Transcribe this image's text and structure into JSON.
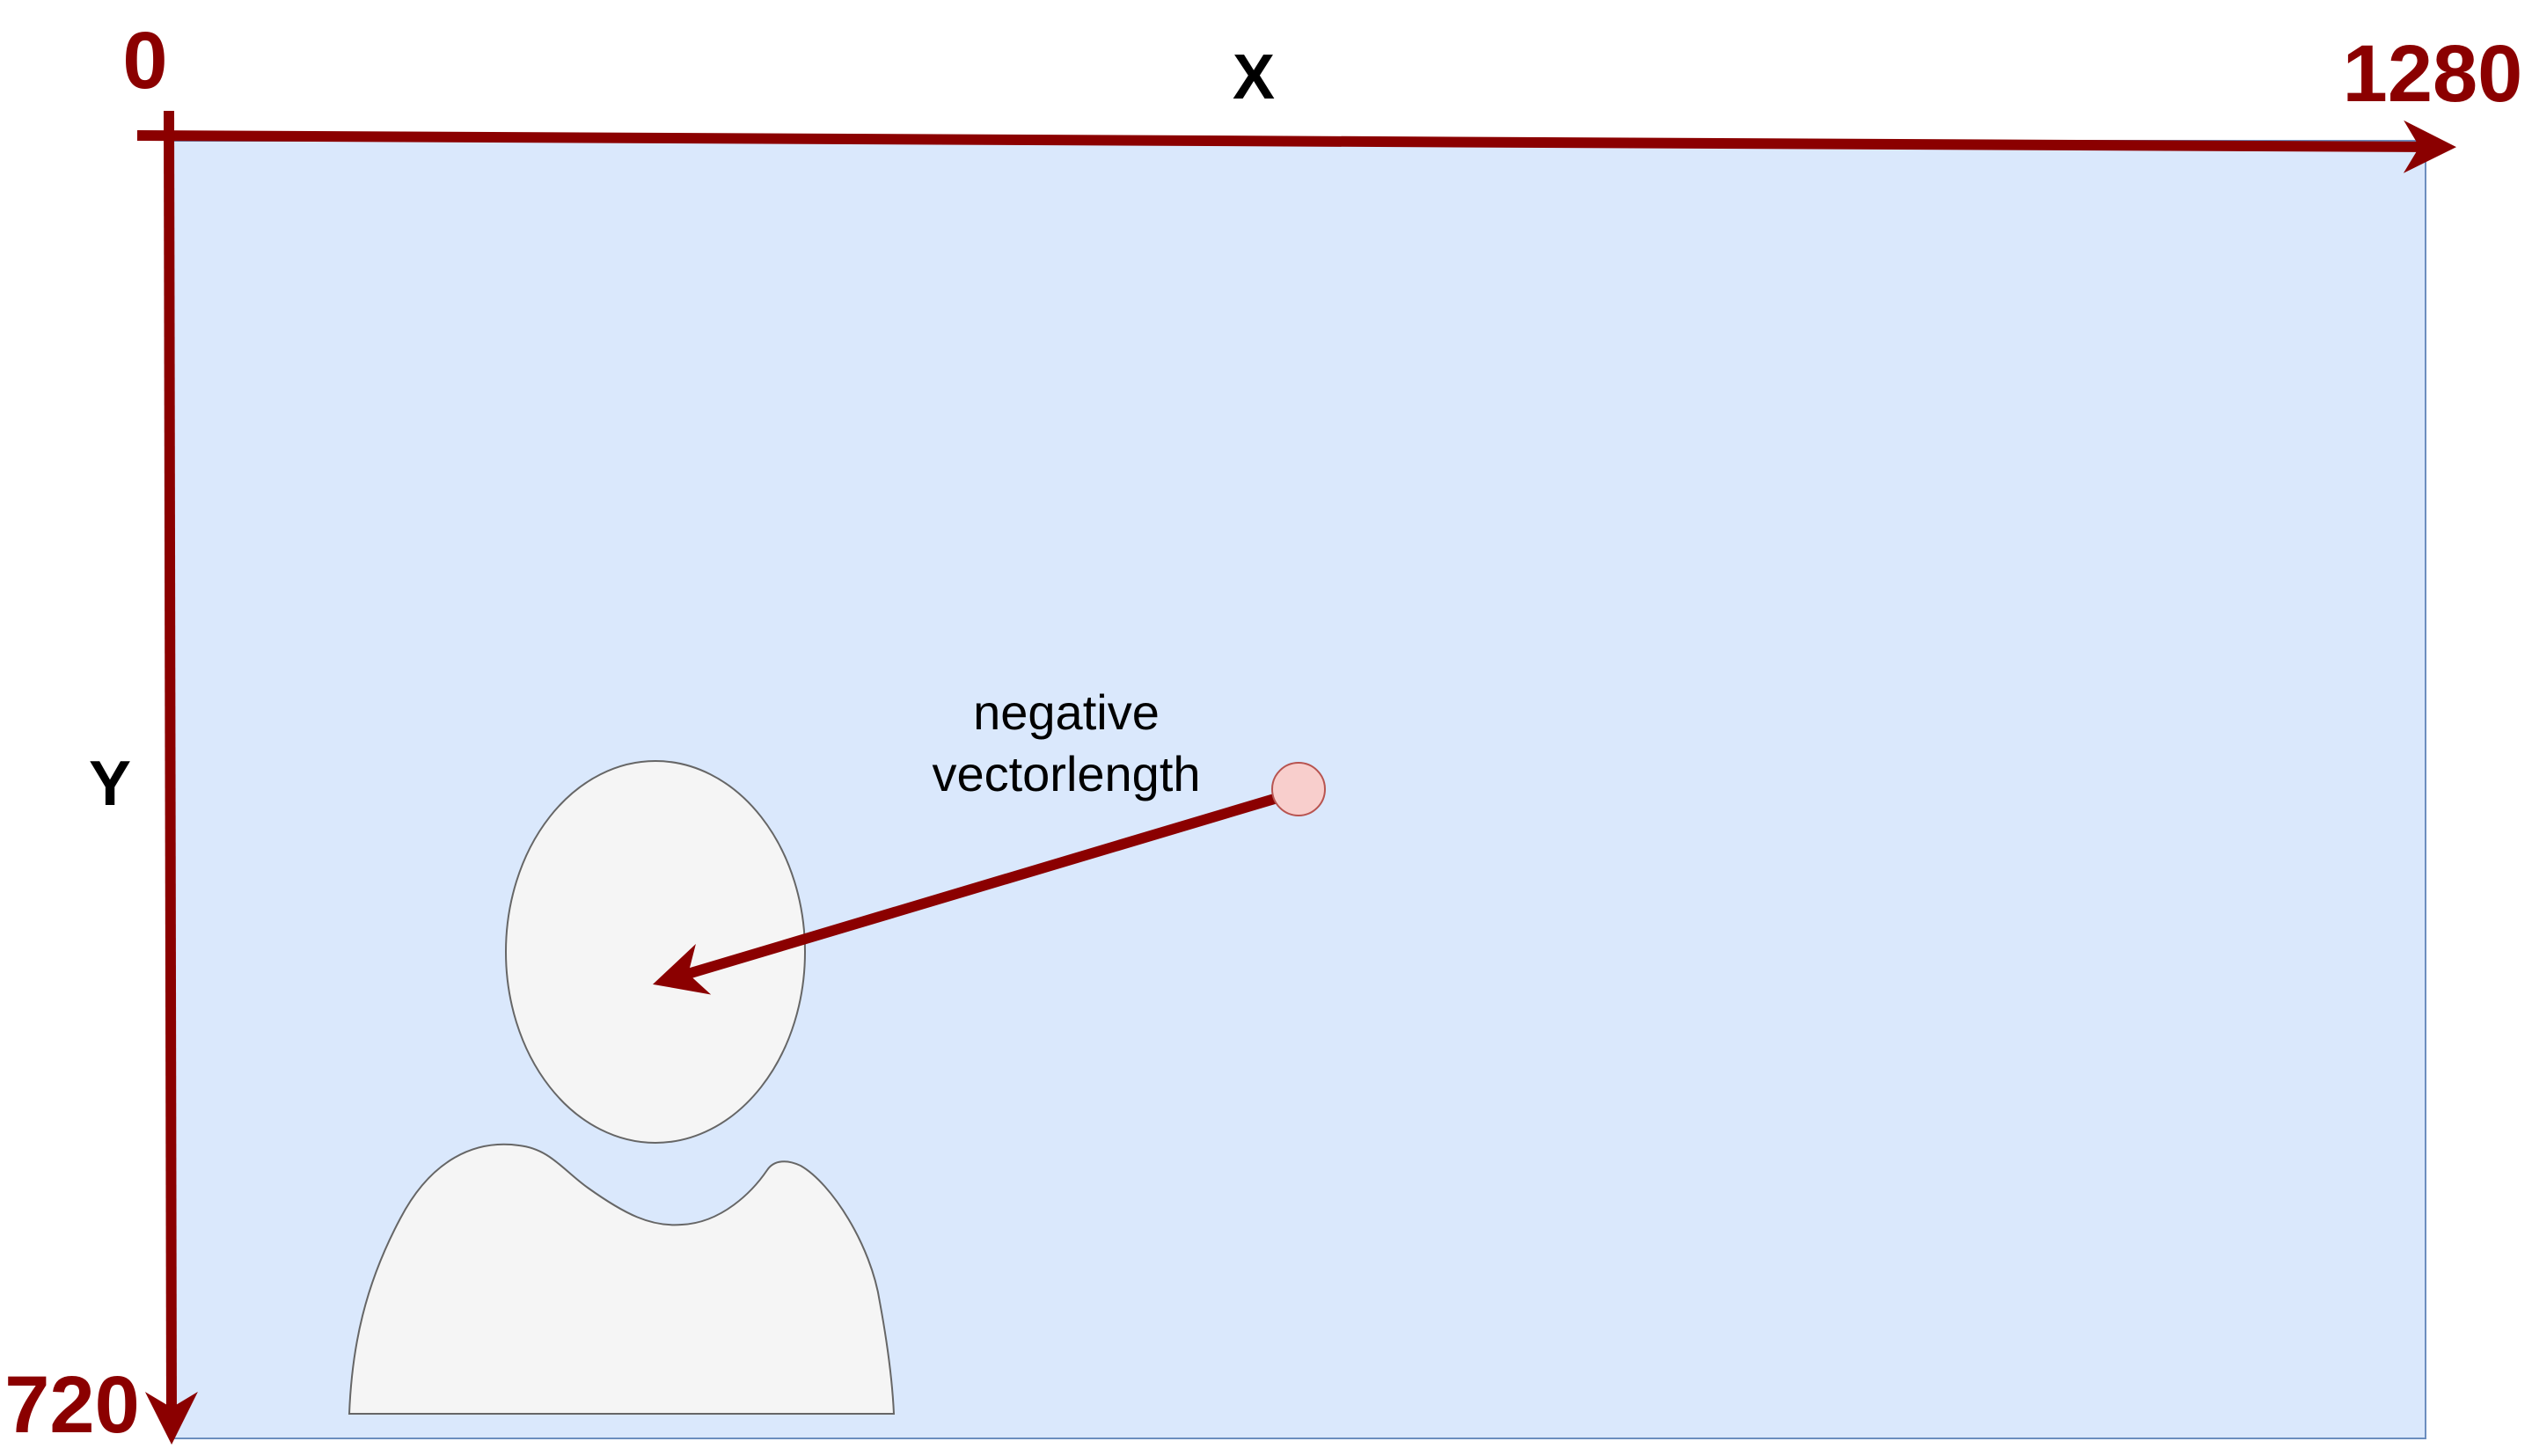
{
  "axes": {
    "x_label": "X",
    "y_label": "Y",
    "origin_label": "0",
    "x_max_label": "1280",
    "y_max_label": "720"
  },
  "annotation": {
    "line1": "negative",
    "line2": "vectorlength"
  },
  "colors": {
    "axis": "#8b0000",
    "canvas_fill": "#dae8fc",
    "canvas_stroke": "#6c8ebf",
    "person_fill": "#f5f5f5",
    "person_stroke": "#666666",
    "point_fill": "#f8cecc",
    "point_stroke": "#b85450",
    "text": "#000000"
  },
  "icons": {
    "person": "person-silhouette-icon",
    "point": "gaze-point-icon"
  }
}
